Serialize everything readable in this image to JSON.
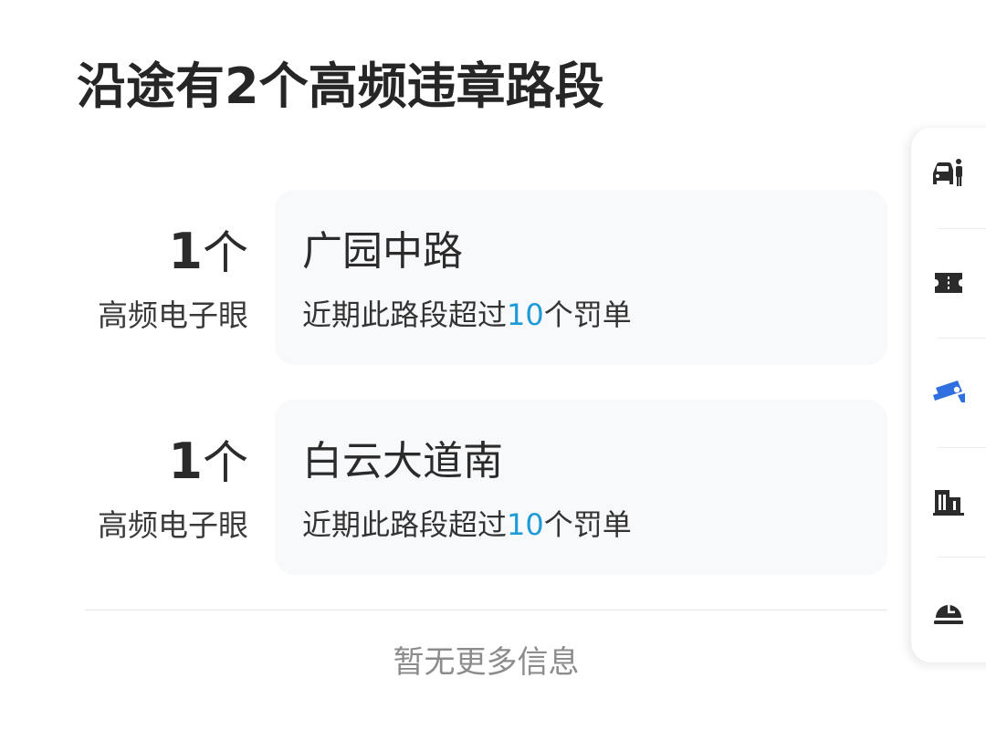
{
  "title": "沿途有2个高频违章路段",
  "segments": [
    {
      "count_number": "1",
      "count_unit": "个",
      "count_label": "高频电子眼",
      "road_name": "广园中路",
      "desc_prefix": "近期此路段超过",
      "desc_number": "10",
      "desc_suffix": "个罚单"
    },
    {
      "count_number": "1",
      "count_unit": "个",
      "count_label": "高频电子眼",
      "road_name": "白云大道南",
      "desc_prefix": "近期此路段超过",
      "desc_number": "10",
      "desc_suffix": "个罚单"
    }
  ],
  "footer": {
    "no_more": "暂无更多信息"
  },
  "side_panel": {
    "items": [
      {
        "icon": "car-pedestrian-icon",
        "active": false
      },
      {
        "icon": "ticket-icon",
        "active": false
      },
      {
        "icon": "camera-icon",
        "active": true
      },
      {
        "icon": "building-icon",
        "active": false
      },
      {
        "icon": "clock-icon",
        "active": false
      }
    ]
  },
  "colors": {
    "highlight": "#1d9bd7",
    "active_icon": "#2f6fe0",
    "icon": "#2b2b2b",
    "card_bg": "#f8f9fb"
  }
}
